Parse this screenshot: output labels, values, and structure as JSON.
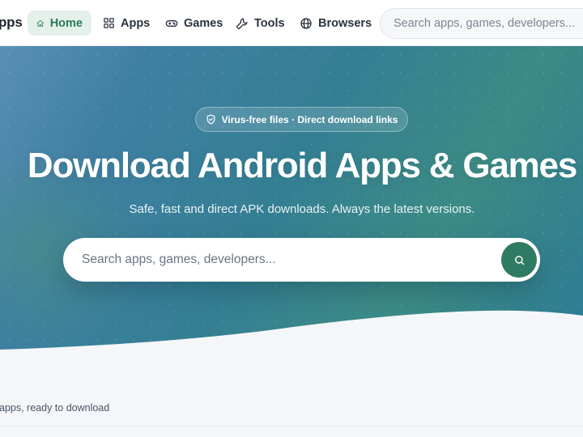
{
  "nav": {
    "brand_fragment": "pps",
    "items": [
      {
        "label": "Home",
        "icon": "home-icon",
        "active": true
      },
      {
        "label": "Apps",
        "icon": "grid-icon",
        "active": false
      },
      {
        "label": "Games",
        "icon": "gamepad-icon",
        "active": false
      },
      {
        "label": "Tools",
        "icon": "wrench-icon",
        "active": false
      },
      {
        "label": "Browsers",
        "icon": "globe-icon",
        "active": false
      }
    ],
    "search_placeholder": "Search apps, games, developers..."
  },
  "hero": {
    "badge_text": "Virus-free files · Direct download links",
    "title": "Download Android Apps & Games",
    "subtitle": "Safe, fast and direct APK downloads. Always the latest versions.",
    "search_placeholder": "Search apps, games, developers..."
  },
  "stats": {
    "text": "apps, ready to download"
  },
  "colors": {
    "accent": "#2f7a63",
    "active_nav_bg": "#e4f0ea",
    "hero_start": "#5a8fb6",
    "hero_end": "#2d7b94"
  }
}
